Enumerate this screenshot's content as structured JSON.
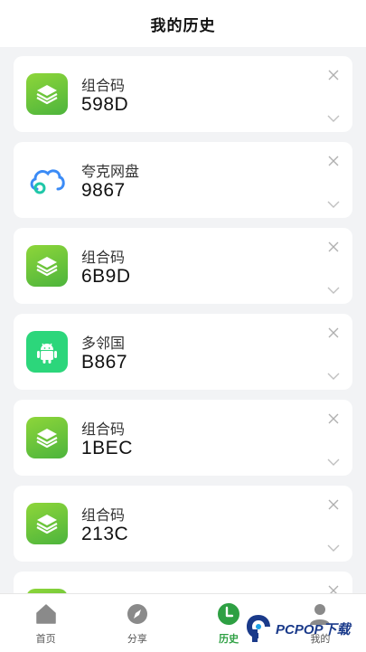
{
  "header": {
    "title": "我的历史"
  },
  "history": [
    {
      "icon": "layers-icon",
      "app": "组合码",
      "code": "598D"
    },
    {
      "icon": "cloud-icon",
      "app": "夸克网盘",
      "code": "9867"
    },
    {
      "icon": "layers-icon",
      "app": "组合码",
      "code": "6B9D"
    },
    {
      "icon": "android-icon",
      "app": "多邻国",
      "code": "B867"
    },
    {
      "icon": "layers-icon",
      "app": "组合码",
      "code": "1BEC"
    },
    {
      "icon": "layers-icon",
      "app": "组合码",
      "code": "213C"
    },
    {
      "icon": "layers-icon",
      "app": "",
      "code": ""
    }
  ],
  "tabs": [
    {
      "id": "home",
      "label": "首页",
      "icon": "home-icon",
      "active": false
    },
    {
      "id": "share",
      "label": "分享",
      "icon": "compass-icon",
      "active": false
    },
    {
      "id": "history",
      "label": "历史",
      "icon": "clock-icon",
      "active": true
    },
    {
      "id": "mine",
      "label": "我的",
      "icon": "user-icon",
      "active": false
    }
  ],
  "watermark": {
    "text": "PCPOP下载"
  },
  "colors": {
    "accent": "#2ea043",
    "icon_green": "#6cc63c",
    "android_green": "#2cd67b",
    "background": "#f2f3f5"
  }
}
